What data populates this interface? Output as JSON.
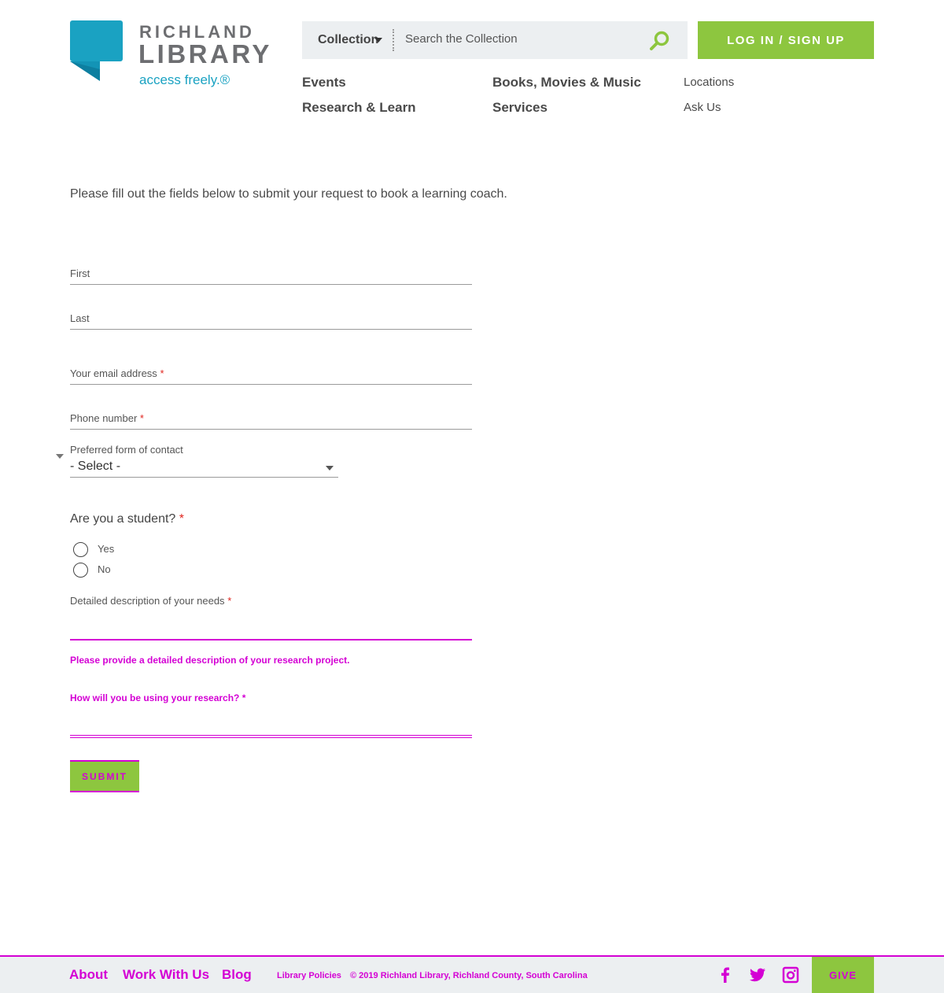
{
  "header": {
    "logo": {
      "line1": "RICHLAND",
      "line2": "LIBRARY",
      "tagline": "access freely.®"
    },
    "search": {
      "scope_label": "Collection",
      "placeholder": "Search the Collection",
      "icon": "search-icon"
    },
    "login_label": "LOG IN / SIGN UP",
    "nav": {
      "events": "Events",
      "research": "Research & Learn",
      "books": "Books, Movies & Music",
      "services": "Services",
      "locations": "Locations",
      "ask_us": "Ask Us"
    }
  },
  "form": {
    "intro": "Please fill out the fields below to submit your request to book a learning coach.",
    "first_label": "First",
    "last_label": "Last",
    "email_label": "Your email address",
    "phone_label": "Phone number",
    "required_mark": "*",
    "contact_label": "Preferred form of contact",
    "contact_value": "- Select -",
    "student_question": "Are you a student?",
    "options": [
      "Yes",
      "No"
    ],
    "desc_label": "Detailed description of your needs",
    "desc_help": "Please provide a detailed description of your research project.",
    "use_label": "How will you be using your research?",
    "submit_label": "SUBMIT"
  },
  "footer": {
    "about": "About",
    "work": "Work With Us",
    "blog": "Blog",
    "policies": "Library Policies",
    "copyright": "© 2019 Richland Library, Richland County, South Carolina",
    "give": "GIVE",
    "icons": [
      "facebook-icon",
      "twitter-icon",
      "instagram-icon"
    ]
  },
  "colors": {
    "brand_green": "#8dc63f",
    "brand_blue": "#1aa2c2",
    "required_red": "#e0261f",
    "highlight_magenta": "#d400d4"
  }
}
